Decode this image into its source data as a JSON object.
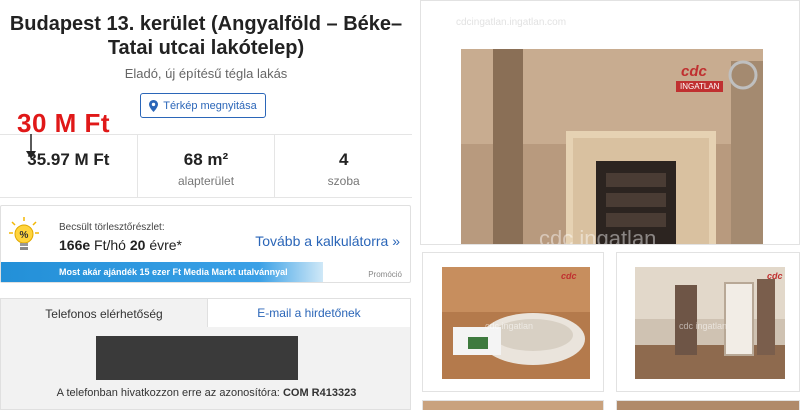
{
  "listing": {
    "title": "Budapest 13. kerület (Angyalföld – Béke–Tatai utcai lakótelep)",
    "subtitle": "Eladó, új építésű tégla lakás",
    "map_button": "Térkép megnyitása"
  },
  "annotation": {
    "new_price": "30 M Ft"
  },
  "stats": {
    "price": "35.97 M Ft",
    "area_value": "68 m²",
    "area_label": "alapterület",
    "rooms_value": "4",
    "rooms_label": "szoba"
  },
  "loan": {
    "label": "Becsült törlesztőrészlet:",
    "amount": "166e",
    "unit": "Ft/hó",
    "years": "20",
    "years_suffix": "évre*",
    "link": "Tovább a kalkulátorra »",
    "promo": "Most akár ajándék 15 ezer Ft Media Markt utalvánnyal",
    "promo_tag": "Promóció"
  },
  "contact": {
    "tab_phone": "Telefonos elérhetőség",
    "tab_email": "E-mail a hirdetőnek",
    "note_prefix": "A telefonban hivatkozzon erre az azonosítóra:",
    "ref_id": "COM R413323"
  },
  "photos": {
    "watermark_site": "cdcingatlan.ingatlan.com",
    "watermark_brand": "cdc ingatlan",
    "logo_cdc": "cdc",
    "logo_ingatlan": "INGATLAN"
  },
  "colors": {
    "accent": "#2b66b8",
    "annotation": "#e01818",
    "promo": "#2390d8"
  }
}
